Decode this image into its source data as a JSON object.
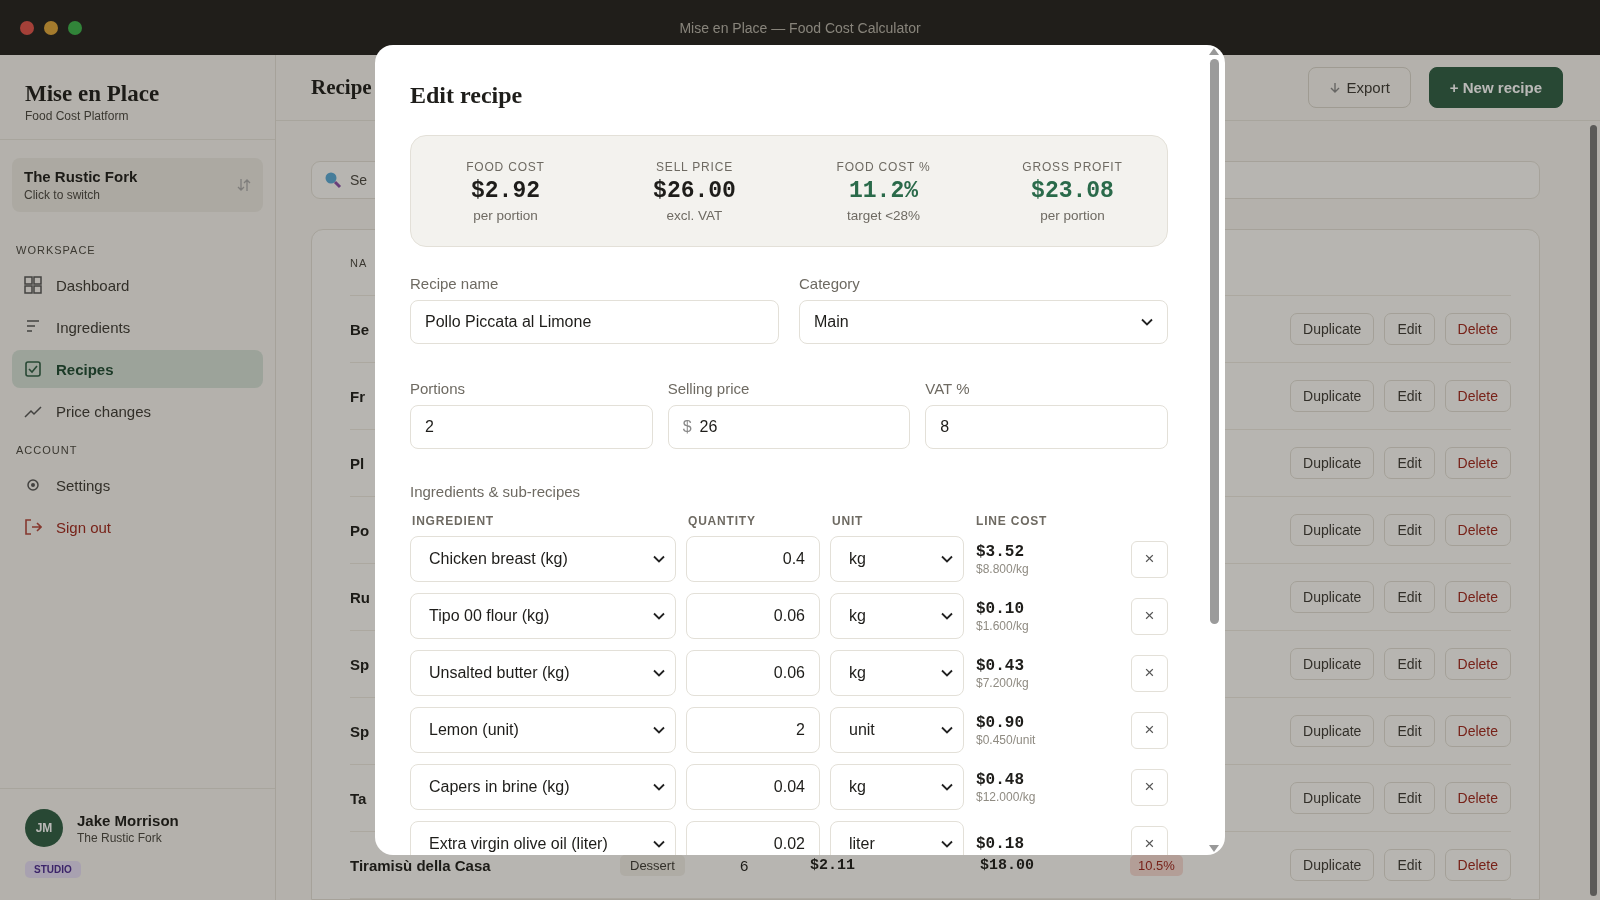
{
  "window": {
    "title": "Mise en Place — Food Cost Calculator"
  },
  "sidebar": {
    "brand": "Mise en Place",
    "tagline": "Food Cost Platform",
    "venue": {
      "name": "The Rustic Fork",
      "hint": "Click to switch"
    },
    "sections": [
      {
        "heading": "WORKSPACE",
        "items": [
          {
            "label": "Dashboard",
            "kind": "nav",
            "selected": false
          },
          {
            "label": "Ingredients",
            "kind": "nav",
            "selected": false
          },
          {
            "label": "Recipes",
            "kind": "nav",
            "selected": true
          },
          {
            "label": "Price changes",
            "kind": "nav",
            "selected": false
          }
        ]
      },
      {
        "heading": "ACCOUNT",
        "items": [
          {
            "label": "Settings",
            "kind": "nav",
            "selected": false
          },
          {
            "label": "Sign out",
            "kind": "danger",
            "selected": false
          }
        ]
      }
    ],
    "user": {
      "initials": "JM",
      "name": "Jake Morrison",
      "venue": "The Rustic Fork",
      "plan": "STUDIO"
    }
  },
  "main": {
    "title": "Recipe",
    "actions": [
      {
        "label": "Export",
        "kind": "secondary"
      },
      {
        "label": "+ New recipe",
        "kind": "primary"
      }
    ],
    "search": {
      "placeholder": "Se"
    },
    "table": {
      "column_1": "NA",
      "rows": [
        {
          "name": "Be",
          "actions": [
            "Duplicate",
            "Edit",
            "Delete"
          ]
        },
        {
          "name": "Fr",
          "actions": [
            "Duplicate",
            "Edit",
            "Delete"
          ]
        },
        {
          "name": "Pl",
          "actions": [
            "Duplicate",
            "Edit",
            "Delete"
          ]
        },
        {
          "name": "Po",
          "actions": [
            "Duplicate",
            "Edit",
            "Delete"
          ]
        },
        {
          "name": "Ru",
          "actions": [
            "Duplicate",
            "Edit",
            "Delete"
          ]
        },
        {
          "name": "Sp",
          "actions": [
            "Duplicate",
            "Edit",
            "Delete"
          ]
        },
        {
          "name": "Sp",
          "actions": [
            "Duplicate",
            "Edit",
            "Delete"
          ]
        },
        {
          "name": "Ta",
          "actions": [
            "Duplicate",
            "Edit",
            "Delete"
          ]
        },
        {
          "name": "Tiramisù della Casa",
          "category": "Dessert",
          "portions": "6",
          "cost": "$2.11",
          "price": "$18.00",
          "food_cost_pct": "10.5%",
          "actions": [
            "Duplicate",
            "Edit",
            "Delete"
          ]
        }
      ]
    }
  },
  "modal": {
    "title": "Edit recipe",
    "summary": [
      {
        "label": "FOOD COST",
        "value": "$2.92",
        "note": "per portion",
        "color": "#1e1d1a"
      },
      {
        "label": "SELL PRICE",
        "value": "$26.00",
        "note": "excl. VAT",
        "color": "#1e1d1a"
      },
      {
        "label": "FOOD COST %",
        "value": "11.2%",
        "note": "target <28%",
        "color": "#2a6a4a"
      },
      {
        "label": "GROSS PROFIT",
        "value": "$23.08",
        "note": "per portion",
        "color": "#2a6a4a"
      }
    ],
    "fields": [
      {
        "label": "Recipe name",
        "value": "Pollo Piccata al Limone",
        "kind": "text"
      },
      {
        "label": "Category",
        "value": "Main",
        "kind": "select"
      },
      {
        "label": "Portions",
        "value": "2",
        "kind": "text"
      },
      {
        "label": "Selling price",
        "prefix": "$",
        "value": "26",
        "kind": "text"
      },
      {
        "label": "VAT %",
        "value": "8",
        "kind": "text"
      }
    ],
    "ingredients": {
      "heading": "Ingredients & sub-recipes",
      "columns": [
        "INGREDIENT",
        "QUANTITY",
        "UNIT",
        "LINE COST"
      ],
      "rows": [
        {
          "ingredient": "Chicken breast (kg)",
          "quantity": "0.4",
          "unit": "kg",
          "line_cost": "$3.52",
          "unit_cost": "$8.800/kg",
          "remove": "×"
        },
        {
          "ingredient": "Tipo 00 flour (kg)",
          "quantity": "0.06",
          "unit": "kg",
          "line_cost": "$0.10",
          "unit_cost": "$1.600/kg",
          "remove": "×"
        },
        {
          "ingredient": "Unsalted butter (kg)",
          "quantity": "0.06",
          "unit": "kg",
          "line_cost": "$0.43",
          "unit_cost": "$7.200/kg",
          "remove": "×"
        },
        {
          "ingredient": "Lemon (unit)",
          "quantity": "2",
          "unit": "unit",
          "line_cost": "$0.90",
          "unit_cost": "$0.450/unit",
          "remove": "×"
        },
        {
          "ingredient": "Capers in brine (kg)",
          "quantity": "0.04",
          "unit": "kg",
          "line_cost": "$0.48",
          "unit_cost": "$12.000/kg",
          "remove": "×"
        },
        {
          "ingredient": "Extra virgin olive oil (liter)",
          "quantity": "0.02",
          "unit": "liter",
          "line_cost": "$0.18",
          "remove": "×"
        }
      ]
    }
  }
}
